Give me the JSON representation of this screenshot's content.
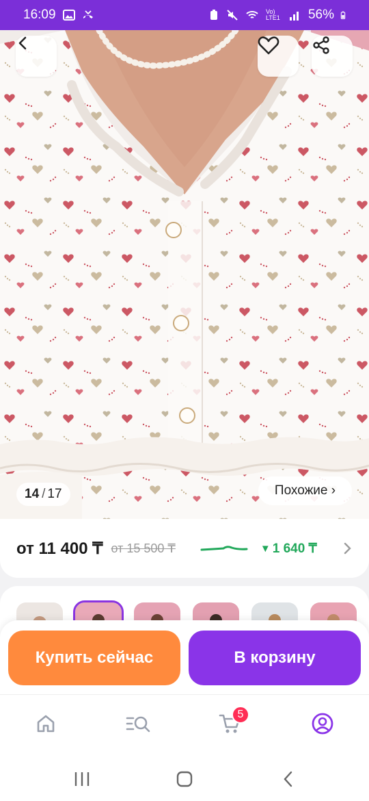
{
  "status_bar": {
    "time": "16:09",
    "battery": "56%",
    "network_label": "Vo) LTE1"
  },
  "gallery": {
    "current": "14",
    "total": "17",
    "similar_label": "Похожие ›"
  },
  "price": {
    "current": "от 11 400 ₸",
    "old": "от 15 500 ₸",
    "drop": "1 640 ₸",
    "drop_arrow": "▼"
  },
  "actions": {
    "buy_now": "Купить сейчас",
    "add_to_cart": "В корзину"
  },
  "bottom_nav": {
    "cart_badge": "5"
  },
  "colors": {
    "status_bar": "#7b2fd8",
    "buy_button": "#ff8a3d",
    "cart_button": "#8a34e8",
    "price_drop": "#21a85a",
    "badge": "#ff2d55"
  }
}
